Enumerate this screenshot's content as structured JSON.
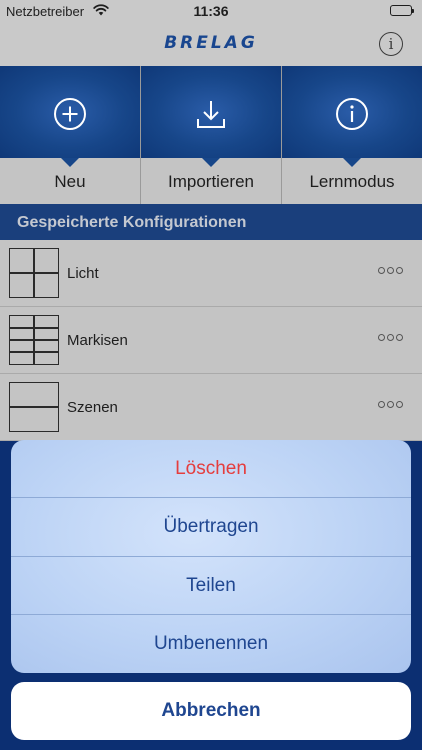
{
  "status_bar": {
    "carrier": "Netzbetreiber",
    "time": "11:36"
  },
  "nav": {
    "logo": "BRELAG",
    "info_glyph": "i"
  },
  "actions": [
    {
      "label": "Neu",
      "icon": "plus-circle-icon"
    },
    {
      "label": "Importieren",
      "icon": "download-icon"
    },
    {
      "label": "Lernmodus",
      "icon": "info-circle-icon"
    }
  ],
  "section": {
    "title": "Gespeicherte Konfigurationen"
  },
  "configurations": [
    {
      "name": "Licht",
      "layout": "grid-2x2"
    },
    {
      "name": "Markisen",
      "layout": "grid-2x4"
    },
    {
      "name": "Szenen",
      "layout": "grid-1x2"
    }
  ],
  "action_sheet": {
    "items": [
      {
        "label": "Löschen",
        "style": "destructive"
      },
      {
        "label": "Übertragen",
        "style": "default"
      },
      {
        "label": "Teilen",
        "style": "default"
      },
      {
        "label": "Umbenennen",
        "style": "default"
      }
    ],
    "cancel_label": "Abbrechen"
  },
  "colors": {
    "brand_blue": "#174689",
    "destructive_red": "#e53d3d",
    "sheet_text_blue": "#1f4690"
  }
}
